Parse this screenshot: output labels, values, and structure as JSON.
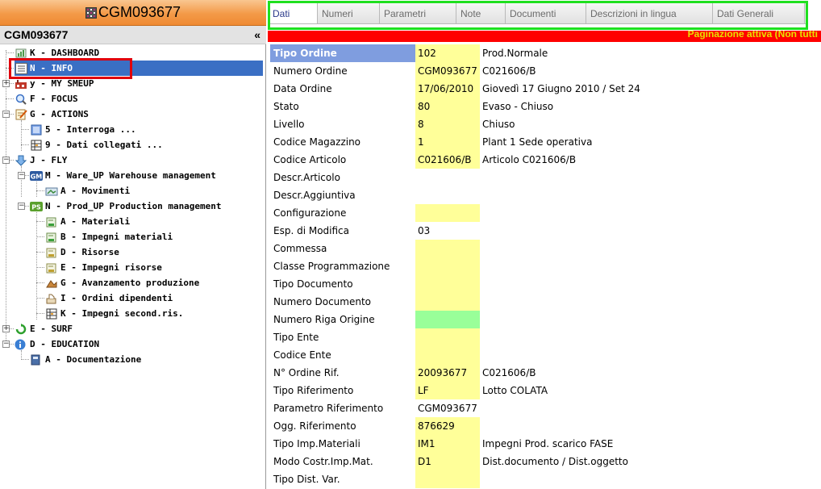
{
  "window": {
    "title": "CGM093677",
    "sub_title": "CGM093677",
    "collapse_glyph": "«"
  },
  "tree": [
    {
      "label": "K - DASHBOARD",
      "icon": "dashboard-icon"
    },
    {
      "label": "N - INFO",
      "icon": "list-icon",
      "selected": true
    },
    {
      "label": "y - MY SMEUP",
      "icon": "factory-icon"
    },
    {
      "label": "F - FOCUS",
      "icon": "magnifier-icon"
    },
    {
      "label": "G - ACTIONS",
      "icon": "notepad-icon"
    },
    {
      "label": "5 - Interroga ...",
      "icon": "window-icon"
    },
    {
      "label": "9 - Dati collegati ...",
      "icon": "table-icon"
    },
    {
      "label": "J - FLY",
      "icon": "down-arrow-icon"
    },
    {
      "label": "M - Ware_UP Warehouse management",
      "icon": "gm-icon",
      "badge": "GM"
    },
    {
      "label": "A - Movimenti",
      "icon": "truck-icon"
    },
    {
      "label": "N - Prod_UP Production management",
      "icon": "ps-icon",
      "badge": "PS"
    },
    {
      "label": "A - Materiali",
      "icon": "material-icon"
    },
    {
      "label": "B - Impegni materiali",
      "icon": "material-icon"
    },
    {
      "label": "D - Risorse",
      "icon": "resource-icon"
    },
    {
      "label": "E - Impegni risorse",
      "icon": "resource-icon"
    },
    {
      "label": "G - Avanzamento produzione",
      "icon": "progress-icon"
    },
    {
      "label": "I - Ordini dipendenti",
      "icon": "order-icon"
    },
    {
      "label": "K - Impegni second.ris.",
      "icon": "table-icon"
    },
    {
      "label": "E - SURF",
      "icon": "refresh-icon"
    },
    {
      "label": "D - EDUCATION",
      "icon": "info-icon"
    },
    {
      "label": "A - Documentazione",
      "icon": "book-icon"
    }
  ],
  "tabs": [
    {
      "label": "Dati",
      "active": true
    },
    {
      "label": "Numeri"
    },
    {
      "label": "Parametri"
    },
    {
      "label": "Note"
    },
    {
      "label": "Documenti"
    },
    {
      "label": "Descrizioni in lingua"
    },
    {
      "label": "Dati Generali"
    }
  ],
  "banner": "Paginazione attiva (Non tutti",
  "fields": [
    {
      "label": "Tipo Ordine",
      "value": "102",
      "desc": "Prod.Normale",
      "header": true
    },
    {
      "label": "Numero Ordine",
      "value": "CGM093677",
      "desc": "C021606/B"
    },
    {
      "label": "Data Ordine",
      "value": "17/06/2010",
      "desc": "Giovedì 17 Giugno 2010 / Set 24"
    },
    {
      "label": "Stato",
      "value": "80",
      "desc": "Evaso - Chiuso"
    },
    {
      "label": "Livello",
      "value": "8",
      "desc": "Chiuso"
    },
    {
      "label": "Codice Magazzino",
      "value": "1",
      "desc": "Plant 1 Sede operativa"
    },
    {
      "label": "Codice Articolo",
      "value": "C021606/B",
      "desc": "Articolo C021606/B"
    },
    {
      "label": "Descr.Articolo",
      "value": "",
      "desc": "",
      "bg": "white"
    },
    {
      "label": "Descr.Aggiuntiva",
      "value": "",
      "desc": "",
      "bg": "white"
    },
    {
      "label": "Configurazione",
      "value": "",
      "desc": ""
    },
    {
      "label": "Esp. di Modifica",
      "value": "03",
      "desc": "",
      "bg": "white"
    },
    {
      "label": "Commessa",
      "value": "",
      "desc": ""
    },
    {
      "label": "Classe Programmazione",
      "value": "",
      "desc": ""
    },
    {
      "label": "Tipo Documento",
      "value": "",
      "desc": ""
    },
    {
      "label": "Numero Documento",
      "value": "",
      "desc": ""
    },
    {
      "label": "Numero Riga Origine",
      "value": "",
      "desc": "",
      "bg": "green"
    },
    {
      "label": "Tipo Ente",
      "value": "",
      "desc": ""
    },
    {
      "label": "Codice Ente",
      "value": "",
      "desc": ""
    },
    {
      "label": "N° Ordine Rif.",
      "value": "20093677",
      "desc": "C021606/B"
    },
    {
      "label": "Tipo Riferimento",
      "value": "LF",
      "desc": "Lotto COLATA"
    },
    {
      "label": "Parametro Riferimento",
      "value": "CGM093677",
      "desc": "",
      "bg": "white"
    },
    {
      "label": "Ogg. Riferimento",
      "value": "876629",
      "desc": ""
    },
    {
      "label": "Tipo Imp.Materiali",
      "value": "IM1",
      "desc": "Impegni Prod. scarico FASE"
    },
    {
      "label": "Modo Costr.Imp.Mat.",
      "value": "D1",
      "desc": "Dist.documento / Dist.oggetto"
    },
    {
      "label": "Tipo Dist. Var.",
      "value": "",
      "desc": ""
    }
  ]
}
